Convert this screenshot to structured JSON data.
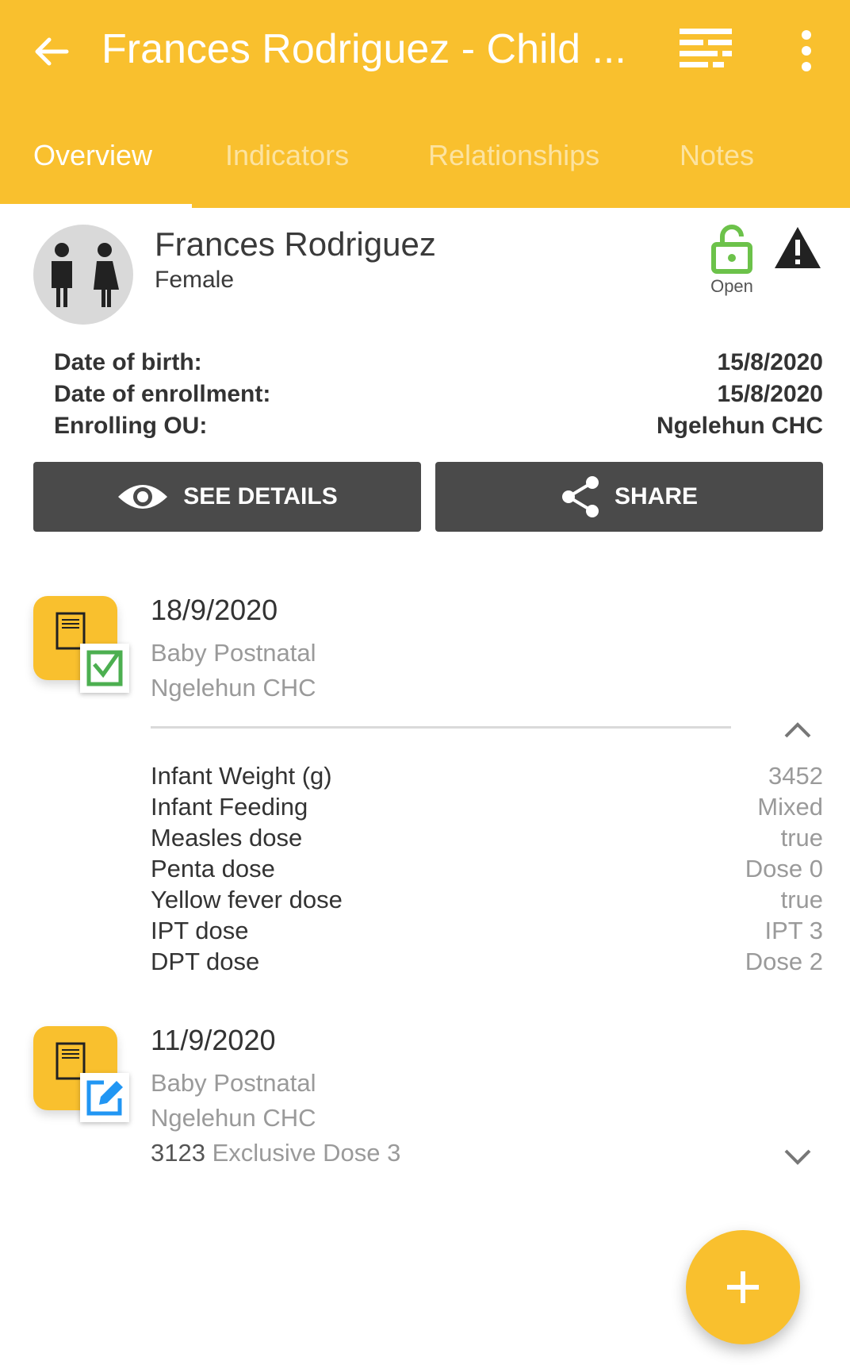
{
  "appbar": {
    "title": "Frances Rodriguez - Child ...",
    "background": "#F9C02E"
  },
  "tabs": [
    "Overview",
    "Indicators",
    "Relationships",
    "Notes"
  ],
  "profile": {
    "name": "Frances Rodriguez",
    "gender": "Female",
    "status_label": "Open",
    "status_color": "#6CC24A",
    "fields": [
      {
        "label": "Date of birth:",
        "value": "15/8/2020"
      },
      {
        "label": "Date of enrollment:",
        "value": "15/8/2020"
      },
      {
        "label": "Enrolling OU:",
        "value": "Ngelehun CHC"
      }
    ]
  },
  "actions": {
    "see_details": "SEE DETAILS",
    "share": "SHARE"
  },
  "events": [
    {
      "date": "18/9/2020",
      "program_stage": "Baby Postnatal",
      "org_unit": "Ngelehun CHC",
      "status": "completed",
      "data_values": [
        {
          "label": "Infant Weight (g)",
          "value": "3452"
        },
        {
          "label": "Infant Feeding",
          "value": "Mixed"
        },
        {
          "label": "Measles dose",
          "value": "true"
        },
        {
          "label": "Penta dose",
          "value": "Dose 0"
        },
        {
          "label": "Yellow fever dose",
          "value": "true"
        },
        {
          "label": "IPT dose",
          "value": "IPT 3"
        },
        {
          "label": "DPT dose",
          "value": "Dose 2"
        }
      ]
    },
    {
      "date": "11/9/2020",
      "program_stage": "Baby Postnatal",
      "org_unit": "Ngelehun CHC",
      "status": "active",
      "summary_value": "3123",
      "summary_rest": "Exclusive Dose 3"
    }
  ],
  "fab": {
    "icon": "plus-icon"
  }
}
